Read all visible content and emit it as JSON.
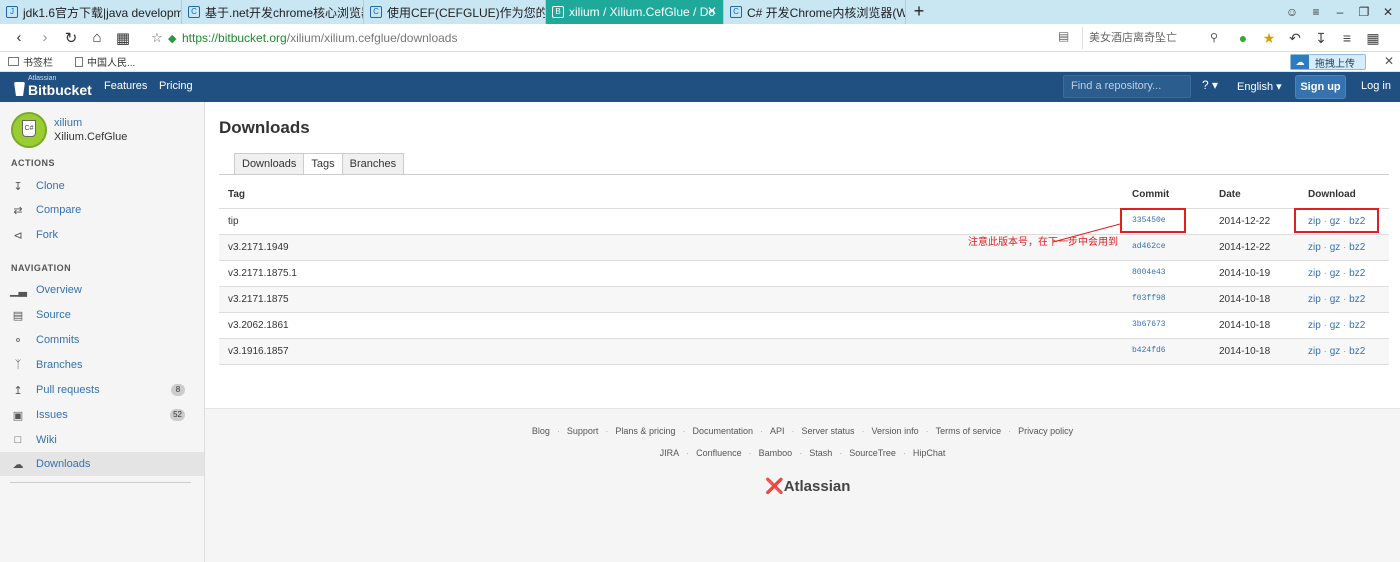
{
  "browser": {
    "tabs": [
      {
        "label": "jdk1.6官方下载|java developme"
      },
      {
        "label": "基于.net开发chrome核心浏览器"
      },
      {
        "label": "使用CEF(CEFGLUE)作为您的客户"
      },
      {
        "label": "xilium / Xilium.CefGlue / Do"
      },
      {
        "label": "C# 开发Chrome内核浏览器(We"
      }
    ],
    "url_host": "https://bitbucket.org",
    "url_path": "/xilium/xilium.cefglue/downloads",
    "search_text": "美女酒店离奇坠亡",
    "bookmarks": [
      {
        "label": "书签栏"
      },
      {
        "label": "中国人民..."
      }
    ],
    "upload_label": "拖拽上传"
  },
  "header": {
    "brand_small": "Atlassian",
    "brand": "Bitbucket",
    "nav": [
      "Features",
      "Pricing"
    ],
    "search_placeholder": "Find a repository...",
    "help": "?",
    "language": "English",
    "signup": "Sign up",
    "login": "Log in"
  },
  "sidebar": {
    "owner": "xilium",
    "repo": "Xilium.CefGlue",
    "avatar_text": "C#",
    "actions_heading": "ACTIONS",
    "actions": [
      {
        "label": "Clone",
        "icon": "clone-icon"
      },
      {
        "label": "Compare",
        "icon": "compare-icon"
      },
      {
        "label": "Fork",
        "icon": "fork-icon"
      }
    ],
    "navigation_heading": "NAVIGATION",
    "navigation": [
      {
        "label": "Overview",
        "icon": "overview-icon"
      },
      {
        "label": "Source",
        "icon": "source-icon"
      },
      {
        "label": "Commits",
        "icon": "commits-icon"
      },
      {
        "label": "Branches",
        "icon": "branches-icon"
      },
      {
        "label": "Pull requests",
        "icon": "pull-requests-icon",
        "badge": "8"
      },
      {
        "label": "Issues",
        "icon": "issues-icon",
        "badge": "52"
      },
      {
        "label": "Wiki",
        "icon": "wiki-icon"
      },
      {
        "label": "Downloads",
        "icon": "downloads-icon"
      }
    ]
  },
  "main": {
    "title": "Downloads",
    "tabs": [
      "Downloads",
      "Tags",
      "Branches"
    ],
    "columns": {
      "tag": "Tag",
      "commit": "Commit",
      "date": "Date",
      "download": "Download"
    },
    "rows": [
      {
        "tag": "tip",
        "commit": "335450e",
        "date": "2014-12-22"
      },
      {
        "tag": "v3.2171.1949",
        "commit": "ad462ce",
        "date": "2014-12-22"
      },
      {
        "tag": "v3.2171.1875.1",
        "commit": "8004e43",
        "date": "2014-10-19"
      },
      {
        "tag": "v3.2171.1875",
        "commit": "f03ff98",
        "date": "2014-10-18"
      },
      {
        "tag": "v3.2062.1861",
        "commit": "3b67673",
        "date": "2014-10-18"
      },
      {
        "tag": "v3.1916.1857",
        "commit": "b424fd6",
        "date": "2014-10-18"
      }
    ],
    "download_formats": [
      "zip",
      "gz",
      "bz2"
    ],
    "annotation": "注意此版本号，在下一步中会用到"
  },
  "footer": {
    "links1": [
      "Blog",
      "Support",
      "Plans & pricing",
      "Documentation",
      "API",
      "Server status",
      "Version info",
      "Terms of service",
      "Privacy policy"
    ],
    "links2": [
      "JIRA",
      "Confluence",
      "Bamboo",
      "Stash",
      "SourceTree",
      "HipChat"
    ],
    "brand": "Atlassian"
  },
  "colors": {
    "header_bg": "#205081",
    "link": "#3572b0",
    "active_tab": "#1fa99a",
    "annotation": "#e02020"
  }
}
